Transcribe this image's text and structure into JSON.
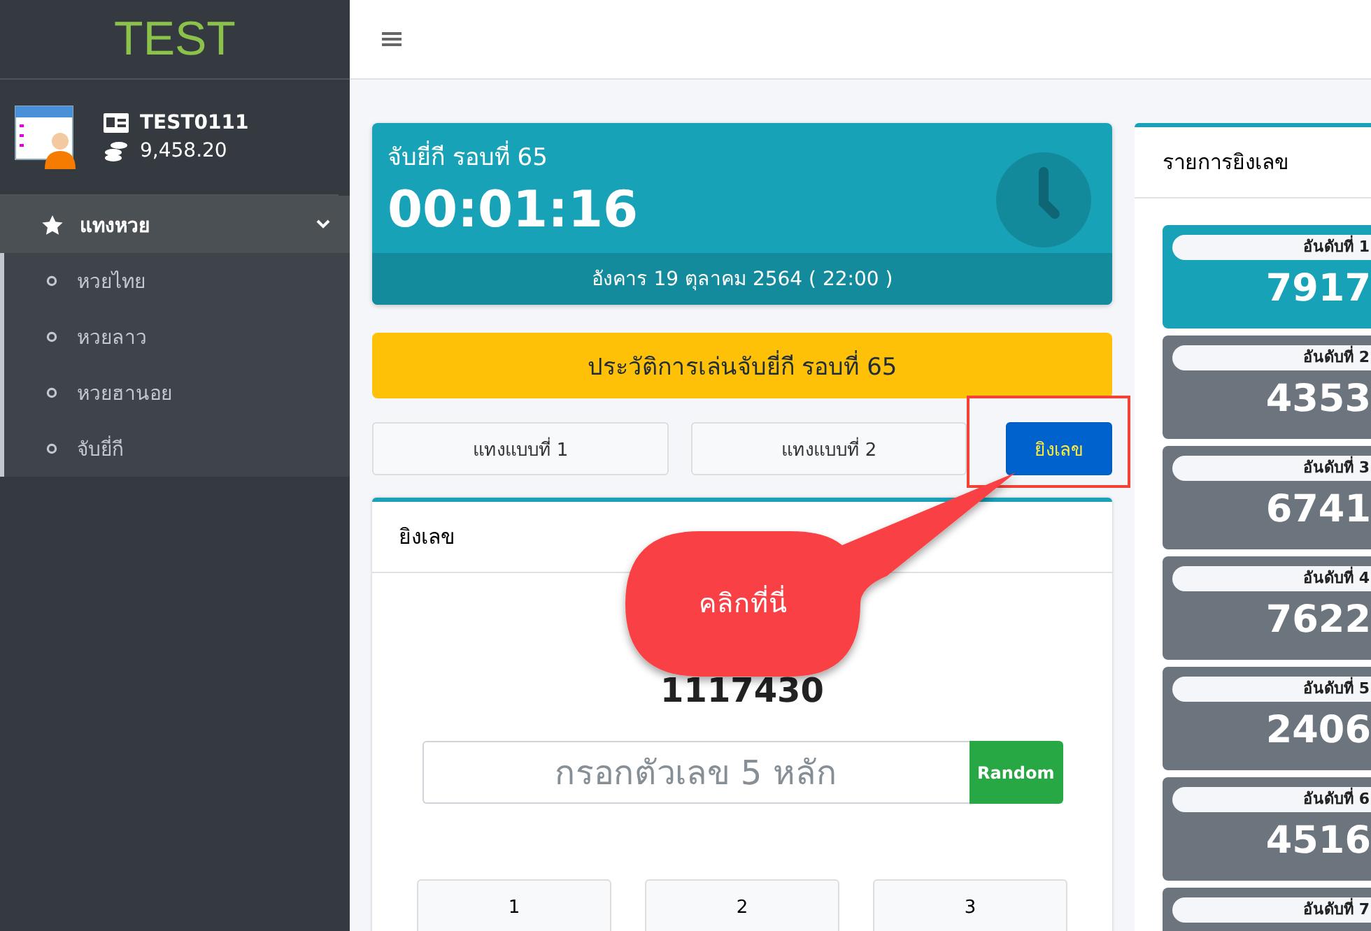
{
  "sidebar": {
    "brand": "TEST",
    "user": {
      "name": "TEST0111",
      "balance": "9,458.20"
    },
    "menu": [
      {
        "label": "แทงหวย",
        "expanded": true,
        "children": [
          {
            "label": "หวยไทย"
          },
          {
            "label": "หวยลาว"
          },
          {
            "label": "หวยฮานอย"
          },
          {
            "label": "จับยี่กี"
          }
        ]
      }
    ]
  },
  "countdown": {
    "title": "จับยี่กี รอบที่ 65",
    "time": "00:01:16",
    "date": "อังคาร 19 ตุลาคม 2564 ( 22:00 )"
  },
  "history_button": "ประวัติการเล่นจับยี่กี รอบที่ 65",
  "mode_tabs": [
    {
      "label": "แทงแบบที่ 1",
      "selected": false
    },
    {
      "label": "แทงแบบที่ 2",
      "selected": false
    },
    {
      "label": "ยิงเลข",
      "selected": true
    }
  ],
  "shoot_panel": {
    "title": "ยิงเลข",
    "number": "1117430",
    "input": {
      "placeholder": "กรอกตัวเลข 5 หลัก"
    },
    "random_button": "Random",
    "keypad": [
      "1",
      "2",
      "3"
    ]
  },
  "callout": {
    "text": "คลิกที่นี่"
  },
  "ranking": {
    "title": "รายการยิงเลข",
    "items": [
      {
        "label": "อันดับที่ 1",
        "number": "7917",
        "selected": true
      },
      {
        "label": "อันดับที่ 2",
        "number": "4353",
        "selected": false
      },
      {
        "label": "อันดับที่ 3",
        "number": "6741",
        "selected": false
      },
      {
        "label": "อันดับที่ 4",
        "number": "7622",
        "selected": false
      },
      {
        "label": "อันดับที่ 5",
        "number": "2406",
        "selected": false
      },
      {
        "label": "อันดับที่ 6",
        "number": "4516",
        "selected": false
      },
      {
        "label": "อันดับที่ 7",
        "selected": false
      }
    ]
  }
}
